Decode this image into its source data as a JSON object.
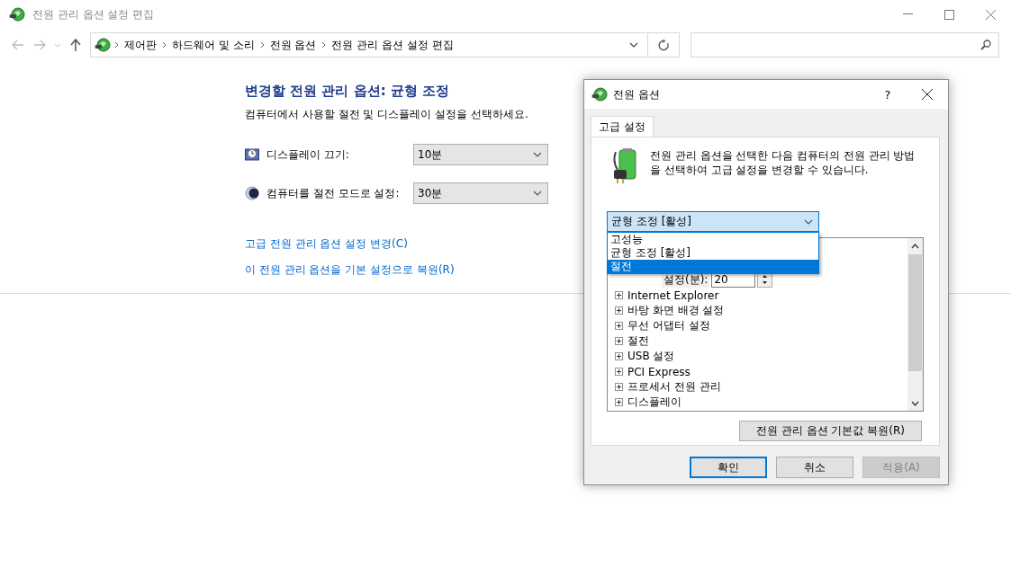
{
  "window": {
    "title": "전원 관리 옵션 설정 편집"
  },
  "address": {
    "breadcrumbs": [
      "제어판",
      "하드웨어 및 소리",
      "전원 옵션",
      "전원 관리 옵션 설정 편집"
    ]
  },
  "content": {
    "heading": "변경할 전원 관리 옵션: 균형 조정",
    "description": "컴퓨터에서 사용할 절전 및 디스플레이 설정을 선택하세요.",
    "settings": [
      {
        "kind": "display",
        "label": "디스플레이 끄기:",
        "value": "10분"
      },
      {
        "kind": "sleep",
        "label": "컴퓨터를 절전 모드로 설정:",
        "value": "30분"
      }
    ],
    "links": [
      "고급 전원 관리 옵션 설정 변경(C)",
      "이 전원 관리 옵션을 기본 설정으로 복원(R)"
    ]
  },
  "dialog": {
    "title": "전원 옵션",
    "help": "?",
    "tabs": [
      {
        "label": "고급 설정",
        "selected": true
      }
    ],
    "description": "전원 관리 옵션을 선택한 다음 컴퓨터의 전원 관리 방법을 선택하여 고급 설정을 변경할 수 있습니다.",
    "plan_combo": {
      "value": "균형 조정 [활성]"
    },
    "plan_options": [
      {
        "label": "고성능",
        "selected": false
      },
      {
        "label": "균형 조정 [활성]",
        "selected": false
      },
      {
        "label": "절전",
        "selected": true
      }
    ],
    "tree": {
      "setting_label": "설정(분):",
      "setting_value": "20",
      "items": [
        {
          "label": "Internet Explorer",
          "expanded": false
        },
        {
          "label": "바탕 화면 배경 설정",
          "expanded": false
        },
        {
          "label": "무선 어댑터 설정",
          "expanded": false
        },
        {
          "label": "절전",
          "expanded": false
        },
        {
          "label": "USB 설정",
          "expanded": false
        },
        {
          "label": "PCI Express",
          "expanded": false
        },
        {
          "label": "프로세서 전원 관리",
          "expanded": false
        },
        {
          "label": "디스플레이",
          "expanded": false
        }
      ]
    },
    "restore_button": "전원 관리 옵션 기본값 복원(R)",
    "buttons": [
      {
        "label": "확인",
        "kind": "default",
        "disabled": false
      },
      {
        "label": "취소",
        "kind": "normal",
        "disabled": false
      },
      {
        "label": "적용(A)",
        "kind": "normal",
        "disabled": true
      }
    ]
  }
}
